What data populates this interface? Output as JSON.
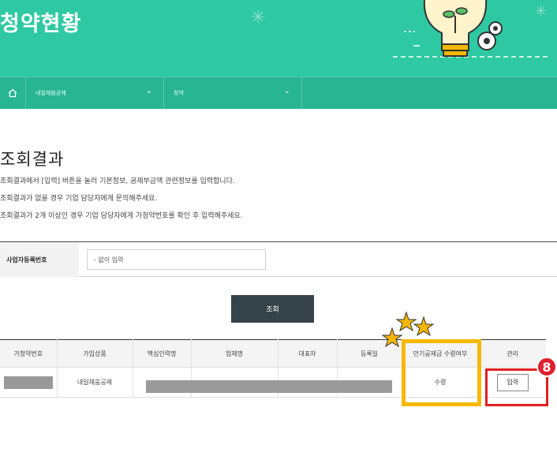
{
  "banner": {
    "title": "청약현황"
  },
  "nav": {
    "dropdown1": "내일채움공제",
    "dropdown2": "청약"
  },
  "result": {
    "heading": "조회결과",
    "desc": [
      "조회결과에서 [입력] 버튼을 눌러 기본정보, 공제부금액 관련정보를 입력합니다.",
      "조회결과가 없을 경우 기업 담당자에게 문의해주세요.",
      "조회결과가 2개 이상인 경우 기업 담당자에게 가청약번호를 확인 후 입력해주세요."
    ]
  },
  "search": {
    "label": "사업자등록번호",
    "input_value": "- 없이 입력",
    "button_label": "조회"
  },
  "table": {
    "headers": [
      "가청약번호",
      "가입상품",
      "핵심인력명",
      "업체명",
      "대표자",
      "등록일",
      "만기공제금 수령여부",
      "관리"
    ],
    "row": {
      "product": "내일채움공제",
      "receipt": "수령",
      "action_label": "입력"
    }
  },
  "annotation": {
    "badge": "8"
  },
  "colors": {
    "banner": "#2ec9a2",
    "nav": "#27b592",
    "highlight": "#f5b800",
    "marker": "#e02020"
  }
}
